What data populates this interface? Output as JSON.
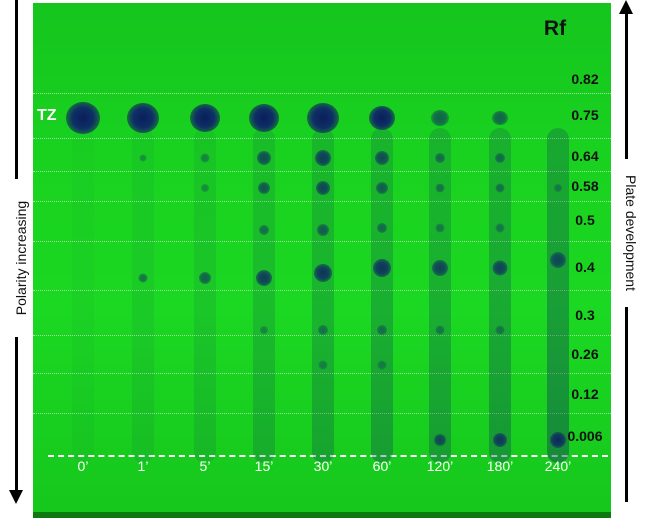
{
  "figure": {
    "left_axis_label": "Polarity increasing",
    "right_axis_label": "Plate development",
    "rf_title": "Rf",
    "compound_label": "TZ",
    "rf_values": [
      "0.82",
      "0.75",
      "0.64",
      "0.58",
      "0.5",
      "0.4",
      "0.3",
      "0.26",
      "0.12",
      "0.006"
    ],
    "lanes": [
      "0’",
      "1’",
      "5’",
      "15’",
      "30’",
      "60’",
      "120’",
      "180’",
      "240’"
    ],
    "colors": {
      "plate": "#1bd822",
      "spot": "#0b1f5a",
      "rf_text": "#111111",
      "lane_text": "#ffffff"
    }
  }
}
